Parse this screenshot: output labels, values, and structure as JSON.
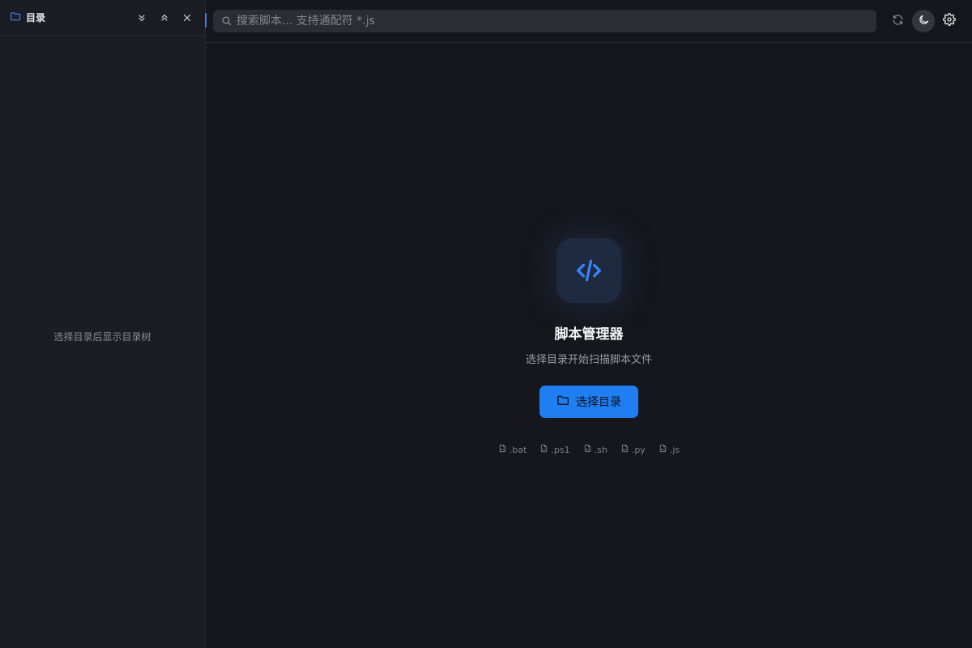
{
  "sidebar": {
    "title": "目录",
    "empty_text": "选择目录后显示目录树",
    "actions": {
      "expand_all_icon": "chevrons-down-icon",
      "collapse_all_icon": "chevrons-up-icon",
      "close_icon": "close-icon"
    }
  },
  "search": {
    "placeholder": "搜索脚本... 支持通配符 *.js",
    "value": ""
  },
  "toolbar": {
    "refresh_icon": "refresh-icon",
    "theme_icon": "moon-icon",
    "settings_icon": "gear-icon"
  },
  "main": {
    "icon": "code-icon",
    "title": "脚本管理器",
    "subtitle": "选择目录开始扫描脚本文件",
    "select_button_label": "选择目录",
    "file_types": [
      ".bat",
      ".ps1",
      ".sh",
      ".py",
      ".js"
    ]
  },
  "colors": {
    "accent": "#1e7ef2",
    "background": "#16171c",
    "sidebar_bg": "#1b1d24"
  }
}
